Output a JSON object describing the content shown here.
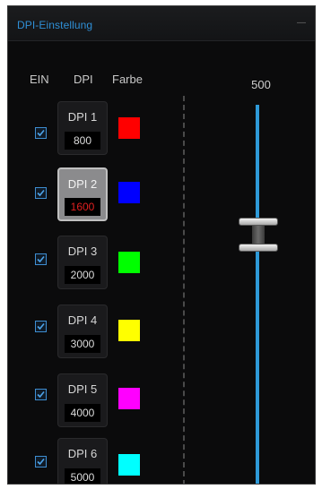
{
  "window": {
    "title": "DPI-Einstellung",
    "control_label": "—"
  },
  "headers": {
    "enable": "EIN",
    "dpi": "DPI",
    "color": "Farbe"
  },
  "slider": {
    "value_label": "500"
  },
  "dpi_levels": [
    {
      "name": "DPI 1",
      "value": "800",
      "color": "#ff0000",
      "enabled": true,
      "selected": false
    },
    {
      "name": "DPI 2",
      "value": "1600",
      "color": "#0000ff",
      "enabled": true,
      "selected": true
    },
    {
      "name": "DPI 3",
      "value": "2000",
      "color": "#00ff00",
      "enabled": true,
      "selected": false
    },
    {
      "name": "DPI 4",
      "value": "3000",
      "color": "#ffff00",
      "enabled": true,
      "selected": false
    },
    {
      "name": "DPI 5",
      "value": "4000",
      "color": "#ff00ff",
      "enabled": true,
      "selected": false
    },
    {
      "name": "DPI 6",
      "value": "5000",
      "color": "#00ffff",
      "enabled": true,
      "selected": false
    }
  ],
  "icons": {
    "checkbox": "checkbox-checked-icon",
    "title_control": "minimize-icon"
  },
  "accent_color": "#2f8fd6"
}
